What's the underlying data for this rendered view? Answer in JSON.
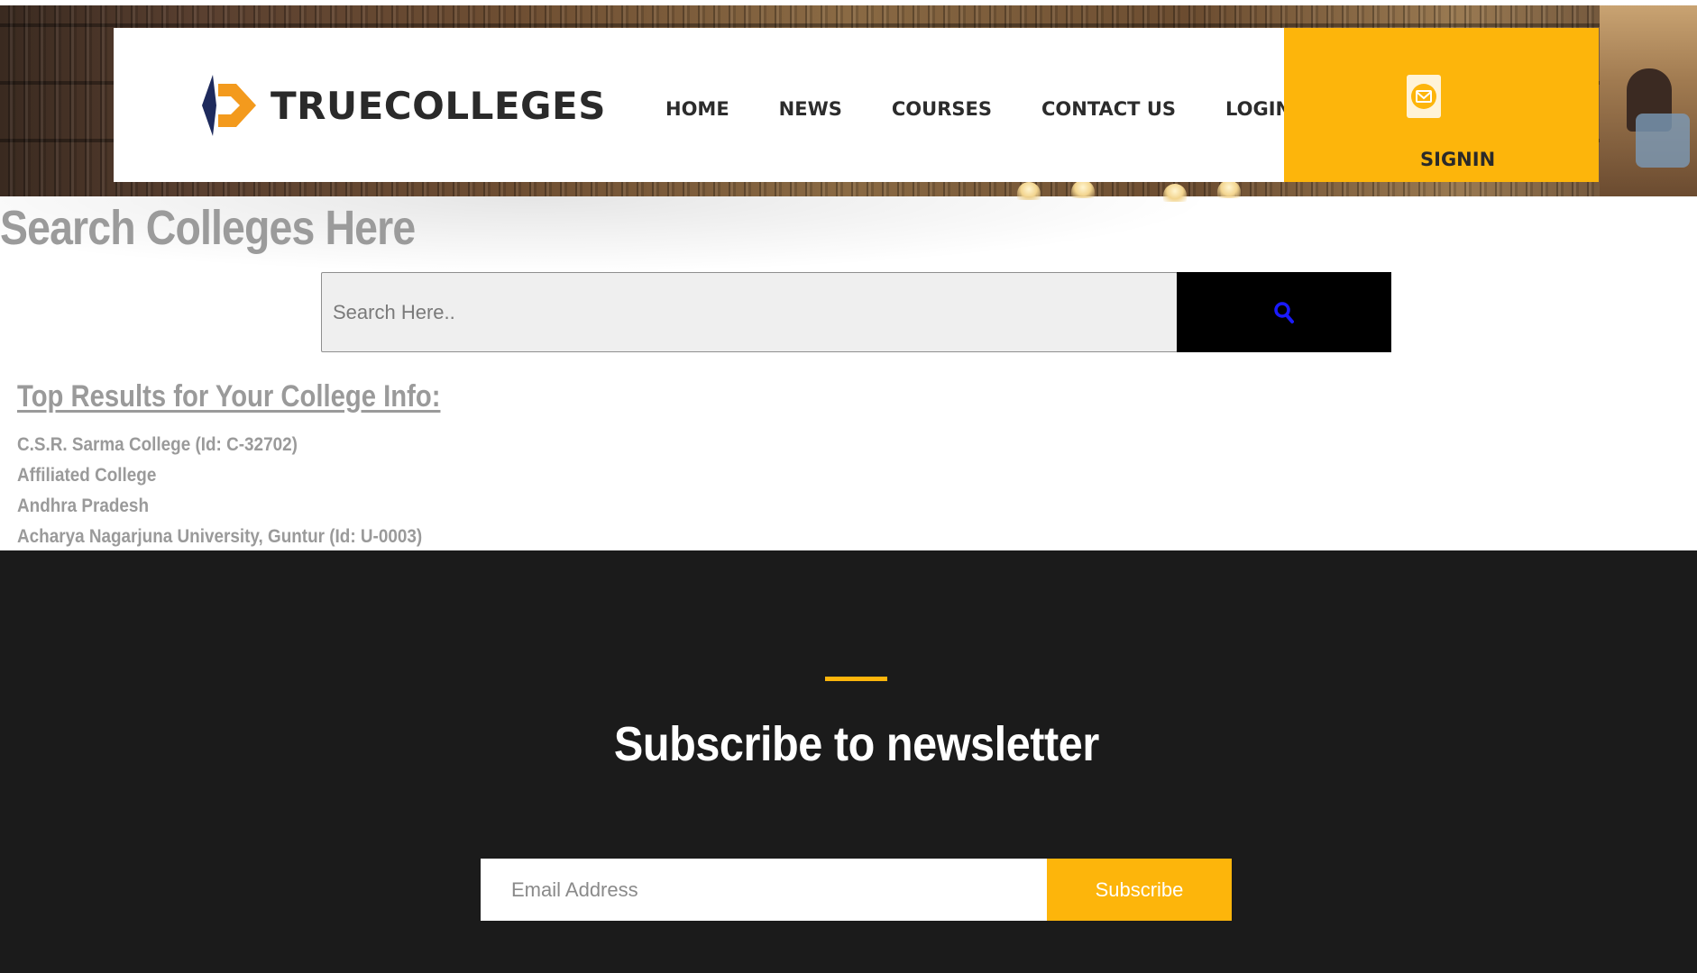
{
  "brand": {
    "name": "TRUECOLLEGES",
    "colors": {
      "accent": "#fdb50b",
      "logo_blue": "#1e2a5c",
      "logo_orange": "#f39a1d"
    }
  },
  "nav": {
    "items": [
      {
        "label": "HOME"
      },
      {
        "label": "NEWS"
      },
      {
        "label": "COURSES"
      },
      {
        "label": "CONTACT US"
      },
      {
        "label": "LOGIN"
      }
    ],
    "signin": {
      "label": "SIGNIN",
      "icon": "envelope-icon"
    }
  },
  "search": {
    "title": "Search Colleges Here",
    "placeholder": "Search Here..",
    "value": "",
    "button_icon": "search-icon"
  },
  "results": {
    "heading": "Top Results for Your College Info:",
    "lines": [
      "C.S.R. Sarma College (Id: C-32702)",
      "Affiliated College",
      "Andhra Pradesh",
      "Acharya Nagarjuna University, Guntur (Id: U-0003)"
    ]
  },
  "newsletter": {
    "title": "Subscribe to newsletter",
    "email_placeholder": "Email Address",
    "email_value": "",
    "subscribe_label": "Subscribe"
  }
}
